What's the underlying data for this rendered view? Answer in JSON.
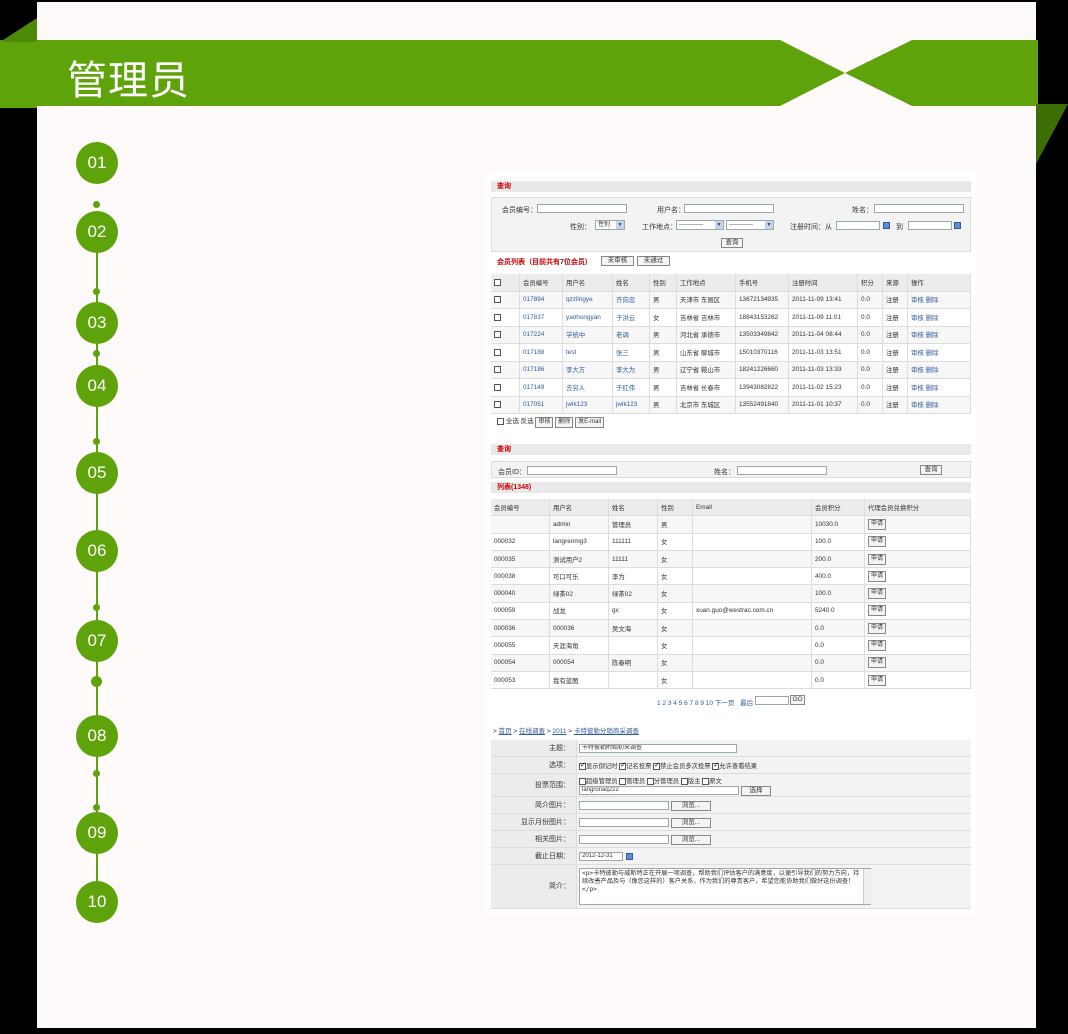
{
  "slide": {
    "title": "管理员",
    "accent": "#5fa30a",
    "steps": [
      "01",
      "02",
      "03",
      "04",
      "05",
      "06",
      "07",
      "08",
      "09",
      "10"
    ]
  },
  "search1": {
    "section_title": "查询",
    "member_no_label": "会员编号：",
    "username_label": "用户名：",
    "name_label": "姓名：",
    "gender_label": "性别：",
    "gender_value": "性别",
    "workplace_label": "工作地点：",
    "workplace_value1": "------------",
    "workplace_value2": "------------",
    "regtime_label": "注册时间：从",
    "to_label": "到",
    "query_button": "查询"
  },
  "list1": {
    "title_prefix": "会员列表（目前共有",
    "count": "7",
    "title_suffix": "位会员）",
    "tab_unreviewed": "未审核",
    "tab_rejected": "未通过",
    "headers": [
      "会员编号",
      "用户名",
      "姓名",
      "性别",
      "工作地点",
      "手机号",
      "注册时间",
      "积分",
      "来源",
      "操作"
    ],
    "action_review": "审核",
    "action_delete": "删除",
    "rows": [
      [
        "017894",
        "qzzlingye",
        "齐向忠",
        "男",
        "天津市 东丽区",
        "13672134935",
        "2011-11-09 13:41",
        "0.0",
        "注册"
      ],
      [
        "017837",
        "yaohongyan",
        "于洪云",
        "女",
        "吉林省 吉林市",
        "18843153262",
        "2011-11-09 11:01",
        "0.0",
        "注册"
      ],
      [
        "017224",
        "学统中",
        "老调",
        "男",
        "河北省 承德市",
        "13503349842",
        "2011-11-04 08:44",
        "0.0",
        "注册"
      ],
      [
        "017188",
        "test",
        "张三",
        "男",
        "山东省 聊城市",
        "15010370116",
        "2011-11-03 13:51",
        "0.0",
        "注册"
      ],
      [
        "017186",
        "李大方",
        "李大为",
        "男",
        "辽宁省 鞍山市",
        "18241226660",
        "2011-11-03 13:33",
        "0.0",
        "注册"
      ],
      [
        "017149",
        "去穷人",
        "于红伟",
        "男",
        "吉林省 长春市",
        "13943082822",
        "2011-11-02 15:23",
        "0.0",
        "注册"
      ],
      [
        "017051",
        "jwlk123",
        "jwlk123",
        "男",
        "北京市 东城区",
        "13552491840",
        "2011-11-01 10:37",
        "0.0",
        "注册"
      ]
    ],
    "select_all": "全选",
    "invert": "反选",
    "btn_review": "审核",
    "btn_delete": "删除",
    "btn_email": "发E-mail"
  },
  "search2": {
    "section_title": "查询",
    "member_id_label": "会员ID：",
    "name_label": "姓名：",
    "query_button": "查询"
  },
  "list2": {
    "title": "列表(1348)",
    "headers": [
      "会员编号",
      "用户名",
      "姓名",
      "性别",
      "Email",
      "会员积分",
      "代理会员兑换积分"
    ],
    "apply": "申请",
    "rows": [
      [
        "",
        "admin",
        "管理员",
        "男",
        "",
        "10030.0"
      ],
      [
        "000032",
        "langrenmg3",
        "111111",
        "女",
        "",
        "100.0"
      ],
      [
        "000035",
        "测试用户2",
        "11111",
        "女",
        "",
        "200.0"
      ],
      [
        "000038",
        "可口可乐",
        "李为",
        "女",
        "",
        "400.0"
      ],
      [
        "000040",
        "绿茶02",
        "绿茶02",
        "女",
        "",
        "100.0"
      ],
      [
        "000059",
        "战龙",
        "gx",
        "女",
        "xuan.guo@westrac.com.cn",
        "5240.0"
      ],
      [
        "000036",
        "000036",
        "吴文海",
        "女",
        "",
        "0.0"
      ],
      [
        "000055",
        "天涯海角",
        "",
        "女",
        "",
        "0.0"
      ],
      [
        "000054",
        "000054",
        "陈春明",
        "女",
        "",
        "0.0"
      ],
      [
        "000053",
        "我有蓝图",
        "",
        "女",
        "",
        "0.0"
      ]
    ],
    "pages": "1 2 3 4 5 6 7 8 9 10",
    "next": "下一页",
    "last": "最后",
    "go": "GO"
  },
  "survey": {
    "crumb_gt": ">",
    "crumb_home": "首页",
    "crumb_online": "在线调查",
    "crumb_year": "2011",
    "crumb_current": "卡特彼勒分销商采调查",
    "subject_label": "主题：",
    "subject_value": "卡特彼勒附始初采调查",
    "options_label": "选项：",
    "opt1": "显示倒记时",
    "opt2": "记名投票",
    "opt3": "禁止会员多次投票",
    "opt4": "允许查看结果",
    "scope_label": "投票范围：",
    "scope1": "超级管理员",
    "scope2": "管理员",
    "scope3": "分管理员",
    "scope4": "版主",
    "scope5": "原文",
    "scope_user": "langronaq222",
    "choose": "选择",
    "intro_img_label": "简介图片：",
    "month_img_label": "显示月份图片：",
    "related_img_label": "相关图片：",
    "browse": "浏览...",
    "deadline_label": "截止日期：",
    "deadline_value": "2012-12-31",
    "desc_label": "简介：",
    "desc_value": "<p>卡特彼勒与威斯特正在开展一项调查，帮助我们评估客户的满意度，以便引导我们的努力方向，持续改善产品及与（像您这样的）客户关系，作为我们的尊贵客户，希望您能协助我们做好这份调查！</p>"
  }
}
